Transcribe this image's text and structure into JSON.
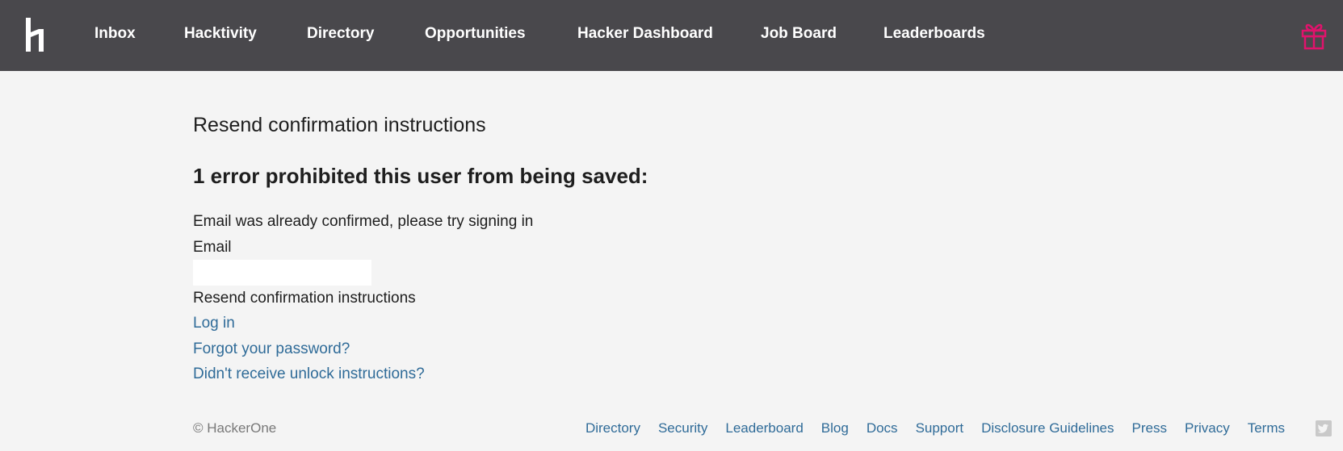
{
  "nav": {
    "logo_icon": "hackerone-h1-logo-icon",
    "items": [
      {
        "label": "Inbox"
      },
      {
        "label": "Hacktivity"
      },
      {
        "label": "Directory"
      },
      {
        "label": "Opportunities"
      },
      {
        "label": "Hacker Dashboard"
      },
      {
        "label": "Job Board"
      },
      {
        "label": "Leaderboards"
      }
    ],
    "gift_icon": "gift-icon",
    "background_color": "#49484c",
    "gift_color": "#e0136c"
  },
  "main": {
    "title": "Resend confirmation instructions",
    "error_heading": "1 error prohibited this user from being saved:",
    "error_message": "Email was already confirmed, please try signing in",
    "email_label": "Email",
    "email_value": "",
    "submit_label": "Resend confirmation instructions",
    "links": {
      "login": "Log in",
      "forgot_password": "Forgot your password?",
      "unlock": "Didn't receive unlock instructions?"
    },
    "link_color": "#2f6b98"
  },
  "footer": {
    "copyright": "© HackerOne",
    "links": [
      {
        "label": "Directory"
      },
      {
        "label": "Security"
      },
      {
        "label": "Leaderboard"
      },
      {
        "label": "Blog"
      },
      {
        "label": "Docs"
      },
      {
        "label": "Support"
      },
      {
        "label": "Disclosure Guidelines"
      },
      {
        "label": "Press"
      },
      {
        "label": "Privacy"
      },
      {
        "label": "Terms"
      }
    ],
    "twitter_icon": "twitter-icon"
  }
}
